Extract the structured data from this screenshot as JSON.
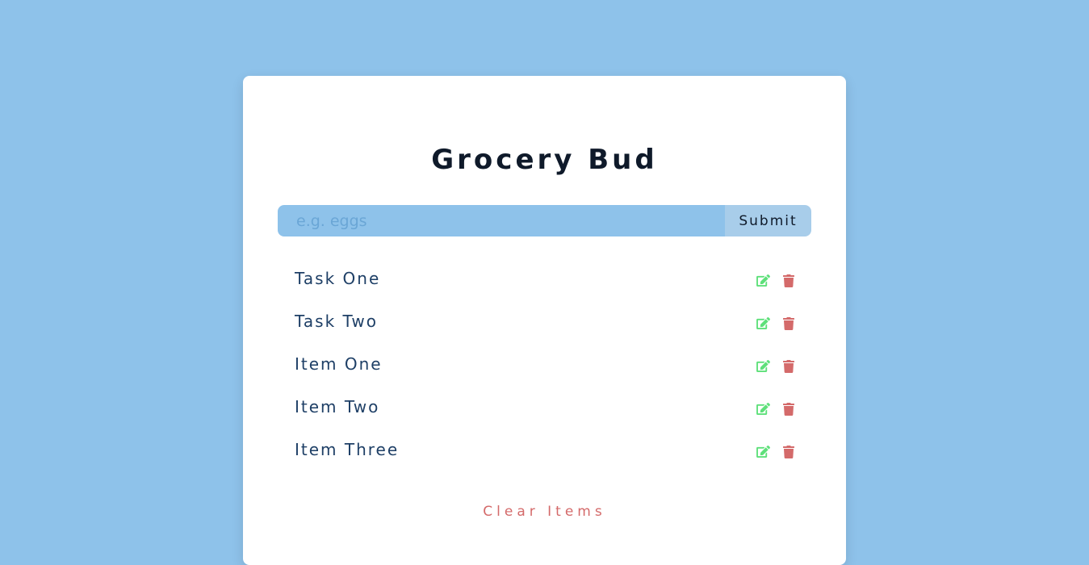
{
  "app": {
    "title": "Grocery Bud"
  },
  "form": {
    "input_value": "",
    "input_placeholder": "e.g. eggs",
    "submit_label": "Submit"
  },
  "items": [
    {
      "title": "Task One",
      "edit_icon": "edit-icon",
      "delete_icon": "trash-icon"
    },
    {
      "title": "Task Two",
      "edit_icon": "edit-icon",
      "delete_icon": "trash-icon"
    },
    {
      "title": "Item One",
      "edit_icon": "edit-icon",
      "delete_icon": "trash-icon"
    },
    {
      "title": "Item Two",
      "edit_icon": "edit-icon",
      "delete_icon": "trash-icon"
    },
    {
      "title": "Item Three",
      "edit_icon": "edit-icon",
      "delete_icon": "trash-icon"
    }
  ],
  "clear_label": "Clear Items",
  "colors": {
    "background": "#8ec2ea",
    "card": "#ffffff",
    "title": "#0f1a2a",
    "item_text": "#1e3f66",
    "edit_icon": "#5ee07a",
    "delete_icon": "#d46a6a",
    "clear_text": "#d46a6a",
    "submit_bg": "#a8cdea"
  }
}
